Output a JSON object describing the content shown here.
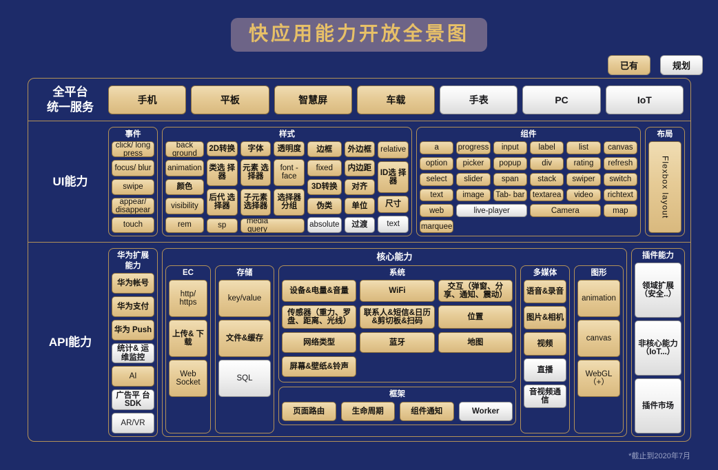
{
  "title": "快应用能力开放全景图",
  "footnote": "*截止到2020年7月",
  "legend": [
    {
      "label": "已有",
      "status": "existing"
    },
    {
      "label": "规划",
      "status": "planned"
    }
  ],
  "colors": {
    "background": "#1d2b69",
    "gold": "#e6cb96",
    "white": "#f2f2f2",
    "border": "#b49258",
    "title_text": "#e7c068",
    "title_pill": "#6d6487"
  },
  "platform_row": {
    "label": "全平台\n统一服务",
    "label_line1": "全平台",
    "label_line2": "统一服务",
    "items": [
      {
        "label": "手机",
        "status": "existing"
      },
      {
        "label": "平板",
        "status": "existing"
      },
      {
        "label": "智慧屏",
        "status": "existing"
      },
      {
        "label": "车载",
        "status": "existing"
      },
      {
        "label": "手表",
        "status": "planned"
      },
      {
        "label": "PC",
        "status": "planned"
      },
      {
        "label": "IoT",
        "status": "planned"
      }
    ]
  },
  "ui_row": {
    "label": "UI能力",
    "groups": {
      "events": {
        "title": "事件",
        "items": [
          {
            "label": "click/ long press",
            "status": "existing"
          },
          {
            "label": "focus/ blur",
            "status": "existing"
          },
          {
            "label": "swipe",
            "status": "existing"
          },
          {
            "label": "appear/ disappear",
            "status": "existing"
          },
          {
            "label": "touch",
            "status": "existing"
          }
        ]
      },
      "styles": {
        "title": "样式",
        "columns": [
          {
            "items": [
              {
                "label": "back ground",
                "status": "existing",
                "span": 1
              },
              {
                "label": "animation",
                "status": "existing",
                "span": 1
              },
              {
                "label": "颜色",
                "status": "existing",
                "span": 1
              },
              {
                "label": "visibility",
                "status": "existing",
                "span": 1
              },
              {
                "label": "rem",
                "status": "existing",
                "span": 1
              }
            ]
          },
          {
            "items": [
              {
                "label": "2D转换",
                "status": "existing",
                "span": 1
              },
              {
                "label": "类选 择器",
                "status": "existing",
                "span": 2
              },
              {
                "label": "后代 选择器",
                "status": "existing",
                "span": 2
              },
              {
                "label": "sp",
                "status": "existing",
                "span": 1
              }
            ]
          },
          {
            "items": [
              {
                "label": "字体",
                "status": "existing",
                "span": 1
              },
              {
                "label": "元素 选择器",
                "status": "existing",
                "span": 2
              },
              {
                "label": "子元素 选择器",
                "status": "existing",
                "span": 2
              },
              {
                "label": "media query",
                "status": "existing",
                "span": 1
              }
            ]
          },
          {
            "items": [
              {
                "label": "透明度",
                "status": "existing",
                "span": 1
              },
              {
                "label": "font - face",
                "status": "existing",
                "span": 2
              },
              {
                "label": "选择器 分组",
                "status": "existing",
                "span": 2
              },
              {
                "label": "_mq_cont",
                "status": "existing",
                "span": 1
              }
            ]
          },
          {
            "items": [
              {
                "label": "边框",
                "status": "existing",
                "span": 1
              },
              {
                "label": "fixed",
                "status": "existing",
                "span": 1
              },
              {
                "label": "3D转换",
                "status": "existing",
                "span": 1
              },
              {
                "label": "伪类",
                "status": "existing",
                "span": 1
              },
              {
                "label": "absolute",
                "status": "planned",
                "span": 1
              }
            ]
          },
          {
            "items": [
              {
                "label": "外边框",
                "status": "existing",
                "span": 1
              },
              {
                "label": "内边距",
                "status": "existing",
                "span": 1
              },
              {
                "label": "对齐",
                "status": "existing",
                "span": 1
              },
              {
                "label": "单位",
                "status": "existing",
                "span": 1
              },
              {
                "label": "过渡",
                "status": "planned",
                "span": 1
              }
            ]
          },
          {
            "items": [
              {
                "label": "relative",
                "status": "existing",
                "span": 1
              },
              {
                "label": "ID选 择器",
                "status": "existing",
                "span": 2
              },
              {
                "label": "尺寸",
                "status": "existing",
                "span": 1
              },
              {
                "label": "text",
                "status": "planned",
                "span": 1
              }
            ]
          }
        ]
      },
      "components": {
        "title": "组件",
        "items": [
          {
            "label": "a",
            "status": "existing",
            "span": 1
          },
          {
            "label": "progress",
            "status": "existing",
            "span": 1
          },
          {
            "label": "input",
            "status": "existing",
            "span": 1
          },
          {
            "label": "label",
            "status": "existing",
            "span": 1
          },
          {
            "label": "list",
            "status": "existing",
            "span": 1
          },
          {
            "label": "canvas",
            "status": "existing",
            "span": 1
          },
          {
            "label": "option",
            "status": "existing",
            "span": 1
          },
          {
            "label": "picker",
            "status": "existing",
            "span": 1
          },
          {
            "label": "popup",
            "status": "existing",
            "span": 1
          },
          {
            "label": "div",
            "status": "existing",
            "span": 1
          },
          {
            "label": "rating",
            "status": "existing",
            "span": 1
          },
          {
            "label": "refresh",
            "status": "existing",
            "span": 1
          },
          {
            "label": "select",
            "status": "existing",
            "span": 1
          },
          {
            "label": "slider",
            "status": "existing",
            "span": 1
          },
          {
            "label": "span",
            "status": "existing",
            "span": 1
          },
          {
            "label": "stack",
            "status": "existing",
            "span": 1
          },
          {
            "label": "swiper",
            "status": "existing",
            "span": 1
          },
          {
            "label": "switch",
            "status": "existing",
            "span": 1
          },
          {
            "label": "text",
            "status": "existing",
            "span": 1
          },
          {
            "label": "image",
            "status": "existing",
            "span": 1
          },
          {
            "label": "Tab- bar",
            "status": "existing",
            "span": 1
          },
          {
            "label": "textarea",
            "status": "existing",
            "span": 1
          },
          {
            "label": "video",
            "status": "existing",
            "span": 1
          },
          {
            "label": "richtext",
            "status": "existing",
            "span": 1
          },
          {
            "label": "web",
            "status": "existing",
            "span": 1
          },
          {
            "label": "live-player",
            "status": "planned",
            "span": 2
          },
          {
            "label": "Camera",
            "status": "existing",
            "span": 2
          },
          {
            "label": "map",
            "status": "existing",
            "span": 1
          },
          {
            "label": "marquee",
            "status": "existing",
            "span": 1
          }
        ]
      },
      "layout": {
        "title": "布局",
        "items": [
          {
            "label": "Flexbox layout",
            "status": "existing"
          }
        ]
      }
    }
  },
  "api_row": {
    "label": "API能力",
    "groups": {
      "huawei": {
        "title": "华为扩展 能力",
        "title_line1": "华为扩展",
        "title_line2": "能力",
        "items": [
          {
            "label": "华为帐号",
            "status": "existing"
          },
          {
            "label": "华为支付",
            "status": "existing"
          },
          {
            "label": "华为 Push",
            "status": "existing"
          },
          {
            "label": "统计& 运维监控",
            "status": "planned"
          },
          {
            "label": "AI",
            "status": "existing"
          },
          {
            "label": "广告平 台SDK",
            "status": "planned"
          },
          {
            "label": "AR/VR",
            "status": "planned"
          }
        ]
      },
      "core": {
        "title": "核心能力",
        "ec": {
          "title": "EC",
          "items": [
            {
              "label": "http/ https",
              "status": "existing"
            },
            {
              "label": "上传& 下载",
              "status": "existing"
            },
            {
              "label": "Web Socket",
              "status": "existing"
            }
          ]
        },
        "storage": {
          "title": "存储",
          "items": [
            {
              "label": "key/value",
              "status": "existing"
            },
            {
              "label": "文件&缓存",
              "status": "existing"
            },
            {
              "label": "SQL",
              "status": "planned"
            }
          ]
        },
        "system": {
          "title": "系统",
          "items": [
            {
              "label": "设备&电量&音量",
              "status": "existing"
            },
            {
              "label": "WiFi",
              "status": "existing"
            },
            {
              "label": "交互（弹窗、分享、通知、震动）",
              "status": "existing"
            },
            {
              "label": "传感器（重力、罗盘、距离、光线）",
              "status": "existing"
            },
            {
              "label": "联系人&短信&日历&剪切板&扫码",
              "status": "existing"
            },
            {
              "label": "位置",
              "status": "existing"
            },
            {
              "label": "网络类型",
              "status": "existing"
            },
            {
              "label": "蓝牙",
              "status": "existing"
            },
            {
              "label": "地图",
              "status": "existing"
            },
            {
              "label": "屏幕&壁纸&铃声",
              "status": "existing"
            }
          ]
        },
        "framework": {
          "title": "框架",
          "items": [
            {
              "label": "页面路由",
              "status": "existing"
            },
            {
              "label": "生命周期",
              "status": "existing"
            },
            {
              "label": "组件通知",
              "status": "existing"
            },
            {
              "label": "Worker",
              "status": "planned"
            }
          ]
        }
      },
      "multimedia": {
        "title": "多媒体",
        "items": [
          {
            "label": "语音&录音",
            "status": "existing"
          },
          {
            "label": "图片&相机",
            "status": "existing"
          },
          {
            "label": "视频",
            "status": "existing"
          },
          {
            "label": "直播",
            "status": "planned"
          },
          {
            "label": "音视频通信",
            "status": "planned"
          }
        ]
      },
      "graphics": {
        "title": "图形",
        "items": [
          {
            "label": "animation",
            "status": "existing"
          },
          {
            "label": "canvas",
            "status": "existing"
          },
          {
            "label": "WebGL （+）",
            "status": "existing"
          }
        ]
      },
      "plugin": {
        "title": "插件能力",
        "items": [
          {
            "label": "领域扩展 （安全..）",
            "status": "planned"
          },
          {
            "label": "非核心能力 （IoT...）",
            "status": "planned"
          },
          {
            "label": "插件市场",
            "status": "planned"
          }
        ]
      }
    }
  }
}
